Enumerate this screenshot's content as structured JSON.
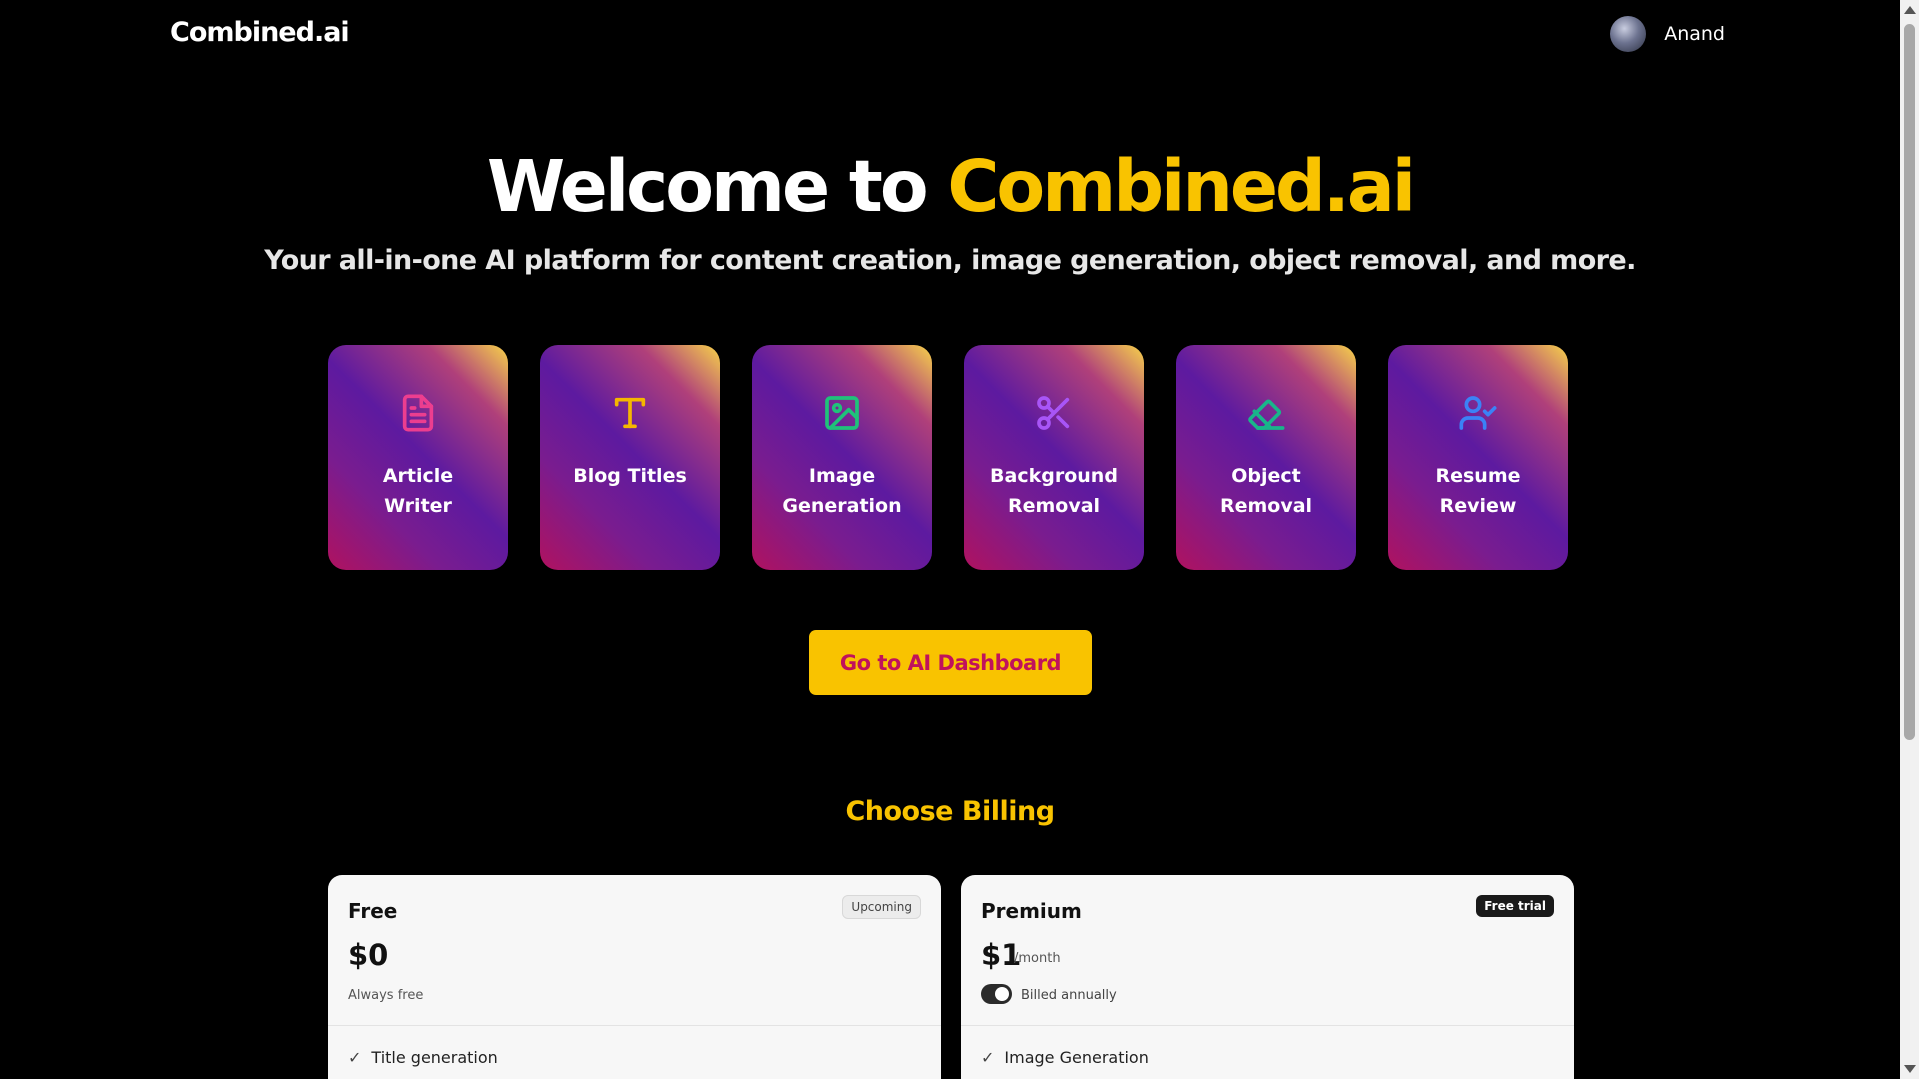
{
  "header": {
    "logo": "Combined.ai",
    "user_name": "Anand"
  },
  "hero": {
    "title_prefix": "Welcome to ",
    "title_accent": "Combined.ai",
    "subtitle": "Your all-in-one AI platform for content creation, image generation, object removal, and more."
  },
  "tools": [
    {
      "label": "Article Writer",
      "icon": "document-icon",
      "color": "#ec3e8f"
    },
    {
      "label": "Blog Titles",
      "icon": "text-t-icon",
      "color": "#f5b700"
    },
    {
      "label": "Image Generation",
      "icon": "image-icon",
      "color": "#1fc27a"
    },
    {
      "label": "Background Removal",
      "icon": "scissors-icon",
      "color": "#a855f7"
    },
    {
      "label": "Object Removal",
      "icon": "eraser-icon",
      "color": "#19b58a"
    },
    {
      "label": "Resume Review",
      "icon": "user-check-icon",
      "color": "#3b82f6"
    }
  ],
  "cta": {
    "label": "Go to AI Dashboard"
  },
  "billing": {
    "title": "Choose Billing",
    "plans": [
      {
        "name": "Free",
        "badge": "Upcoming",
        "price": "$0",
        "note": "Always free",
        "feature": "Title generation"
      },
      {
        "name": "Premium",
        "badge": "Free trial",
        "price": "$1",
        "period": "/month",
        "toggle_label": "Billed annually",
        "toggle_on": true,
        "feature": "Image Generation"
      }
    ]
  },
  "colors": {
    "accent_yellow": "#f9c300",
    "cta_text": "#c0125c",
    "background": "#000000"
  }
}
